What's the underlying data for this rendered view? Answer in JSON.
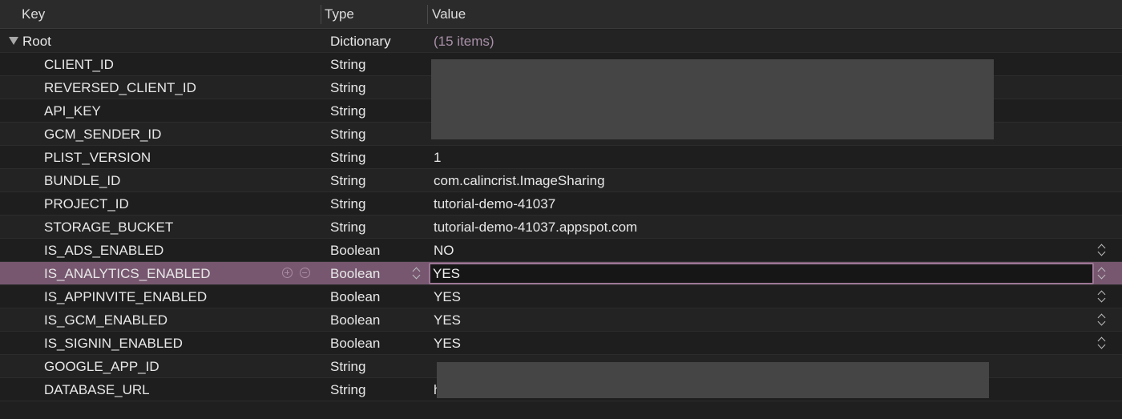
{
  "columns": {
    "key": "Key",
    "type": "Type",
    "value": "Value"
  },
  "root": {
    "key": "Root",
    "type": "Dictionary",
    "value": "(15 items)"
  },
  "rows": [
    {
      "key": "CLIENT_ID",
      "type": "String",
      "value": ""
    },
    {
      "key": "REVERSED_CLIENT_ID",
      "type": "String",
      "value": ""
    },
    {
      "key": "API_KEY",
      "type": "String",
      "value": ""
    },
    {
      "key": "GCM_SENDER_ID",
      "type": "String",
      "value": ""
    },
    {
      "key": "PLIST_VERSION",
      "type": "String",
      "value": "1"
    },
    {
      "key": "BUNDLE_ID",
      "type": "String",
      "value": "com.calincrist.ImageSharing"
    },
    {
      "key": "PROJECT_ID",
      "type": "String",
      "value": "tutorial-demo-41037"
    },
    {
      "key": "STORAGE_BUCKET",
      "type": "String",
      "value": "tutorial-demo-41037.appspot.com"
    },
    {
      "key": "IS_ADS_ENABLED",
      "type": "Boolean",
      "value": "NO"
    },
    {
      "key": "IS_ANALYTICS_ENABLED",
      "type": "Boolean",
      "value": "YES"
    },
    {
      "key": "IS_APPINVITE_ENABLED",
      "type": "Boolean",
      "value": "YES"
    },
    {
      "key": "IS_GCM_ENABLED",
      "type": "Boolean",
      "value": "YES"
    },
    {
      "key": "IS_SIGNIN_ENABLED",
      "type": "Boolean",
      "value": "YES"
    },
    {
      "key": "GOOGLE_APP_ID",
      "type": "String",
      "value": ""
    },
    {
      "key": "DATABASE_URL",
      "type": "String",
      "value": "h"
    }
  ],
  "colors": {
    "background": "#1f1f1f",
    "selected_row": "#77576f",
    "edit_border": "#9c7796",
    "redaction": "#454545"
  },
  "icons": {
    "disclosure": "disclosure-triangle-down-icon",
    "add": "add-circle-icon",
    "remove": "remove-circle-icon",
    "stepper": "up-down-stepper-icon"
  }
}
